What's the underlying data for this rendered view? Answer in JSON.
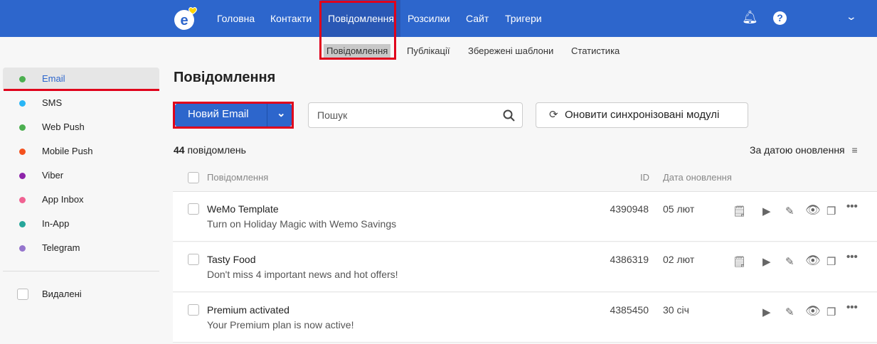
{
  "topnav": {
    "items": [
      "Головна",
      "Контакти",
      "Повідомлення",
      "Розсилки",
      "Сайт",
      "Тригери"
    ]
  },
  "subnav": {
    "items": [
      "Повідомлення",
      "Публікації",
      "Збережені шаблони",
      "Статистика"
    ]
  },
  "sidebar": {
    "items": [
      {
        "label": "Email",
        "color": "#4caf50"
      },
      {
        "label": "SMS",
        "color": "#29b6f6"
      },
      {
        "label": "Web Push",
        "color": "#4caf50"
      },
      {
        "label": "Mobile Push",
        "color": "#f4511e"
      },
      {
        "label": "Viber",
        "color": "#8e24aa"
      },
      {
        "label": "App Inbox",
        "color": "#f06292"
      },
      {
        "label": "In-App",
        "color": "#26a69a"
      },
      {
        "label": "Telegram",
        "color": "#9575cd"
      }
    ],
    "deleted": "Видалені"
  },
  "main": {
    "title": "Повідомлення",
    "new_button": "Новий Email",
    "search_placeholder": "Пошук",
    "sync_button": "Оновити синхронізовані модулі",
    "count": "44",
    "count_label": "повідомлень",
    "sort": "За датою оновлення",
    "columns": {
      "name": "Повідомлення",
      "id": "ID",
      "date": "Дата оновлення"
    },
    "rows": [
      {
        "title": "WeMo Template",
        "subtitle": "Turn on Holiday Magic with Wemo Savings",
        "id": "4390948",
        "date": "05 лют",
        "notes": true
      },
      {
        "title": "Tasty Food",
        "subtitle": "Don't miss 4 important news and hot offers!",
        "id": "4386319",
        "date": "02 лют",
        "notes": true
      },
      {
        "title": "Premium activated",
        "subtitle": "Your Premium plan is now active!",
        "id": "4385450",
        "date": "30 січ",
        "notes": false
      }
    ]
  }
}
